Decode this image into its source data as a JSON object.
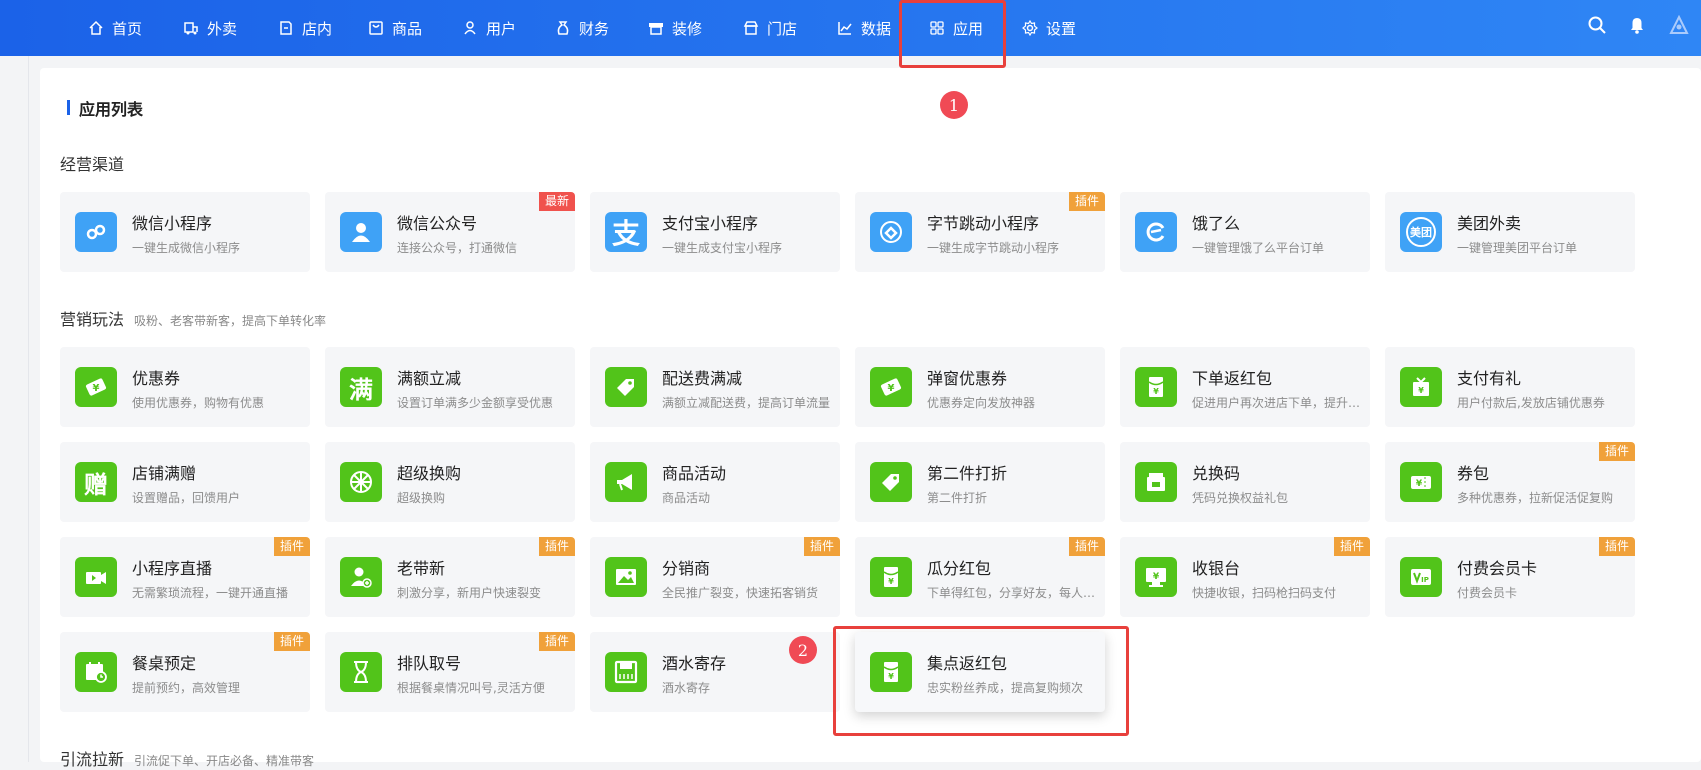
{
  "nav": {
    "items": [
      {
        "label": "首页",
        "icon": "home-icon"
      },
      {
        "label": "外卖",
        "icon": "takeout-icon"
      },
      {
        "label": "店内",
        "icon": "store-in-icon"
      },
      {
        "label": "商品",
        "icon": "goods-icon"
      },
      {
        "label": "用户",
        "icon": "user-icon"
      },
      {
        "label": "财务",
        "icon": "finance-icon"
      },
      {
        "label": "装修",
        "icon": "decorate-icon"
      },
      {
        "label": "门店",
        "icon": "shop-icon"
      },
      {
        "label": "数据",
        "icon": "chart-icon"
      },
      {
        "label": "应用",
        "icon": "apps-icon",
        "active": true
      },
      {
        "label": "设置",
        "icon": "gear-icon"
      }
    ],
    "right_icons": [
      "search-icon",
      "bell-icon",
      "avatar-icon"
    ]
  },
  "page": {
    "title": "应用列表",
    "sections": [
      {
        "title": "经营渠道",
        "subtitle": ""
      },
      {
        "title": "营销玩法",
        "subtitle": "吸粉、老客带新客，提高下单转化率"
      },
      {
        "title": "引流拉新",
        "subtitle": "引流促下单、开店必备、精准带客"
      }
    ]
  },
  "channels": [
    {
      "title": "微信小程序",
      "desc": "一键生成微信小程序",
      "badge": "",
      "icon": "mini-program-icon"
    },
    {
      "title": "微信公众号",
      "desc": "连接公众号，打通微信",
      "badge": "最新",
      "icon": "official-account-icon"
    },
    {
      "title": "支付宝小程序",
      "desc": "一键生成支付宝小程序",
      "badge": "",
      "icon": "alipay-icon"
    },
    {
      "title": "字节跳动小程序",
      "desc": "一键生成字节跳动小程序",
      "badge": "插件",
      "icon": "bytedance-icon"
    },
    {
      "title": "饿了么",
      "desc": "一键管理饿了么平台订单",
      "badge": "",
      "icon": "eleme-icon"
    },
    {
      "title": "美团外卖",
      "desc": "一键管理美团平台订单",
      "badge": "",
      "icon": "meituan-icon",
      "icon_text": "美团"
    }
  ],
  "marketing": [
    {
      "title": "优惠券",
      "desc": "使用优惠券，购物有优惠",
      "badge": "",
      "icon": "coupon-icon"
    },
    {
      "title": "满额立减",
      "desc": "设置订单满多少金额享受优惠",
      "badge": "",
      "icon": "full-reduce-icon",
      "icon_text": "满"
    },
    {
      "title": "配送费满减",
      "desc": "满额立减配送费，提高订单流量",
      "badge": "",
      "icon": "delivery-tag-icon"
    },
    {
      "title": "弹窗优惠券",
      "desc": "优惠券定向发放神器",
      "badge": "",
      "icon": "popup-coupon-icon"
    },
    {
      "title": "下单返红包",
      "desc": "促进用户再次进店下单，提升复购",
      "badge": "",
      "icon": "red-packet-icon"
    },
    {
      "title": "支付有礼",
      "desc": "用户付款后,发放店铺优惠券",
      "badge": "",
      "icon": "pay-gift-icon"
    },
    {
      "title": "店铺满赠",
      "desc": "设置赠品，回馈用户",
      "badge": "",
      "icon": "gift-icon",
      "icon_text": "赠"
    },
    {
      "title": "超级换购",
      "desc": "超级换购",
      "badge": "",
      "icon": "wheel-icon"
    },
    {
      "title": "商品活动",
      "desc": "商品活动",
      "badge": "",
      "icon": "megaphone-icon"
    },
    {
      "title": "第二件打折",
      "desc": "第二件打折",
      "badge": "",
      "icon": "discount-tag-icon"
    },
    {
      "title": "兑换码",
      "desc": "凭码兑换权益礼包",
      "badge": "",
      "icon": "redeem-code-icon"
    },
    {
      "title": "券包",
      "desc": "多种优惠券，拉新促活促复购",
      "badge": "插件",
      "icon": "coupon-pack-icon"
    },
    {
      "title": "小程序直播",
      "desc": "无需繁琐流程，一键开通直播",
      "badge": "插件",
      "icon": "live-camera-icon"
    },
    {
      "title": "老带新",
      "desc": "刺激分享，新用户快速裂变",
      "badge": "插件",
      "icon": "invite-user-icon"
    },
    {
      "title": "分销商",
      "desc": "全民推广裂变，快速拓客销货",
      "badge": "插件",
      "icon": "picture-icon"
    },
    {
      "title": "瓜分红包",
      "desc": "下单得红包，分享好友，每人可得",
      "badge": "插件",
      "icon": "split-packet-icon"
    },
    {
      "title": "收银台",
      "desc": "快捷收银，扫码枪扫码支付",
      "badge": "插件",
      "icon": "cashier-icon"
    },
    {
      "title": "付费会员卡",
      "desc": "付费会员卡",
      "badge": "插件",
      "icon": "vip-card-icon"
    },
    {
      "title": "餐桌预定",
      "desc": "提前预约，高效管理",
      "badge": "插件",
      "icon": "calendar-clock-icon"
    },
    {
      "title": "排队取号",
      "desc": "根据餐桌情况叫号,灵活方便",
      "badge": "插件",
      "icon": "hourglass-icon"
    },
    {
      "title": "酒水寄存",
      "desc": "酒水寄存",
      "badge": "",
      "icon": "storage-icon"
    },
    {
      "title": "集点返红包",
      "desc": "忠实粉丝养成，提高复购频次",
      "badge": "",
      "icon": "points-packet-icon"
    }
  ],
  "annotations": {
    "marker1": "1",
    "marker2": "2"
  },
  "colors": {
    "nav_start": "#1b62e8",
    "nav_end": "#2f86f5",
    "icon_blue": "#3fa2f6",
    "icon_green": "#52c41a",
    "badge_orange": "#f0a13a",
    "badge_red": "#f0524d",
    "highlight_red": "#e8403c"
  }
}
